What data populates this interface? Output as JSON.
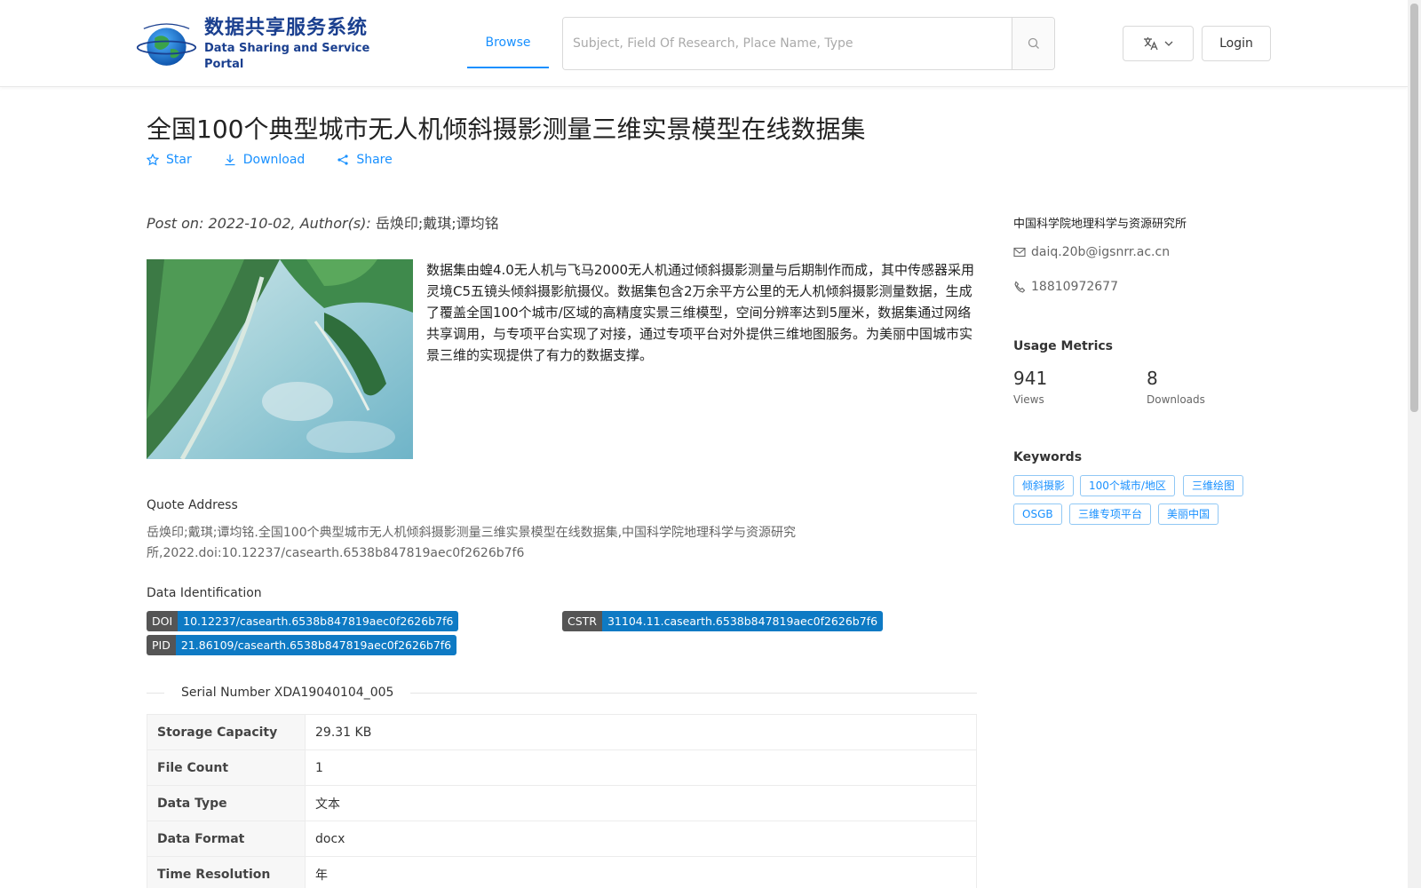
{
  "header": {
    "logo_cn": "数据共享服务系统",
    "logo_en": "Data Sharing and Service Portal",
    "nav_browse": "Browse",
    "search_placeholder": "Subject, Field Of Research, Place Name, Type",
    "login_label": "Login"
  },
  "dataset": {
    "title": "全国100个典型城市无人机倾斜摄影测量三维实景模型在线数据集",
    "actions": {
      "star": "Star",
      "download": "Download",
      "share": "Share"
    },
    "post_on": "Post on: 2022-10-02, Author(s): ",
    "authors": "岳焕印;戴琪;谭均铭",
    "description": "数据集由蝗4.0无人机与飞马2000无人机通过倾斜摄影测量与后期制作而成，其中传感器采用灵境C5五镜头倾斜摄影航摄仪。数据集包含2万余平方公里的无人机倾斜摄影测量数据，生成了覆盖全国100个城市/区域的高精度实景三维模型，空间分辨率达到5厘米，数据集通过网络共享调用，与专项平台实现了对接，通过专项平台对外提供三维地图服务。为美丽中国城市实景三维的实现提供了有力的数据支撑。",
    "quote_heading": "Quote Address",
    "quote_text": "岳焕印;戴琪;谭均铭.全国100个典型城市无人机倾斜摄影测量三维实景模型在线数据集,中国科学院地理科学与资源研究所,2022.doi:10.12237/casearth.6538b847819aec0f2626b7f6",
    "ident_heading": "Data Identification",
    "identifiers": {
      "doi": {
        "key": "DOI",
        "value": "10.12237/casearth.6538b847819aec0f2626b7f6"
      },
      "cstr": {
        "key": "CSTR",
        "value": "31104.11.casearth.6538b847819aec0f2626b7f6"
      },
      "pid": {
        "key": "PID",
        "value": "21.86109/casearth.6538b847819aec0f2626b7f6"
      }
    },
    "serial": "Serial Number XDA19040104_005",
    "table": [
      {
        "label": "Storage Capacity",
        "value": "29.31 KB"
      },
      {
        "label": "File Count",
        "value": "1"
      },
      {
        "label": "Data Type",
        "value": "文本"
      },
      {
        "label": "Data Format",
        "value": "docx"
      },
      {
        "label": "Time Resolution",
        "value": "年"
      }
    ]
  },
  "sidebar": {
    "organization": "中国科学院地理科学与资源研究所",
    "email": "daiq.20b@igsnrr.ac.cn",
    "phone": "18810972677",
    "metrics_heading": "Usage Metrics",
    "views_value": "941",
    "views_label": "Views",
    "downloads_value": "8",
    "downloads_label": "Downloads",
    "keywords_heading": "Keywords",
    "keywords": [
      "倾斜摄影",
      "100个城市/地区",
      "三维绘图",
      "OSGB",
      "三维专项平台",
      "美丽中国"
    ]
  },
  "colors": {
    "accent": "#1890ff",
    "badge_value": "#0e7ac4",
    "badge_key": "#555555",
    "logo_blue": "#1a3f8f"
  }
}
